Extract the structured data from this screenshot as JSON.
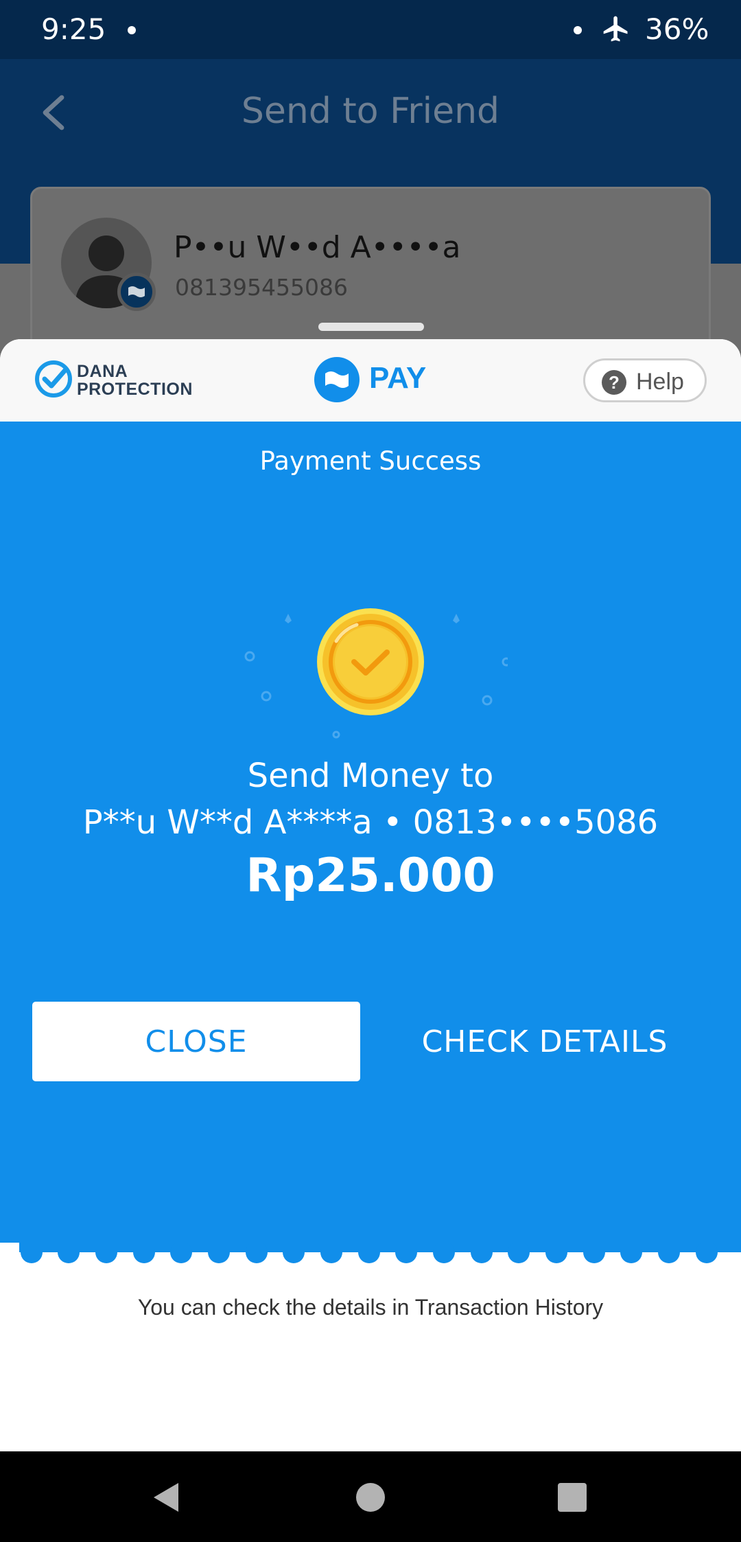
{
  "status_bar": {
    "time": "9:25",
    "battery": "36%",
    "icons": [
      "notification-dot-icon",
      "airplane-icon"
    ]
  },
  "header": {
    "title": "Send to Friend",
    "back_icon": "chevron-left-icon"
  },
  "recipient": {
    "name": "P••u W••d A••••a",
    "phone": "081395455086"
  },
  "sheet": {
    "brand": {
      "line1": "DANA",
      "line2": "PROTECTION"
    },
    "pay_label": "PAY",
    "help_label": "Help",
    "status_title": "Payment Success",
    "send_money_label": "Send Money to",
    "recipient_summary": "P**u W**d A****a • 0813••••5086",
    "amount": "Rp25.000",
    "info_text": "You can check the details in Transaction History",
    "close_label": "CLOSE",
    "check_details_label": "CHECK DETAILS"
  },
  "colors": {
    "accent": "#118eea",
    "status_bar": "#05284c",
    "medal": "#f6c12a"
  }
}
